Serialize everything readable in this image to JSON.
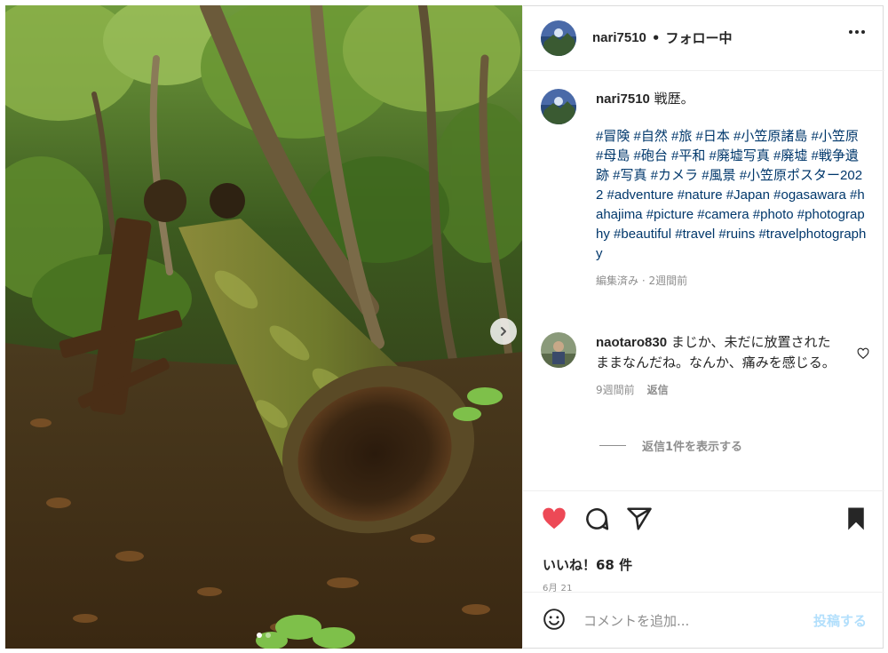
{
  "post": {
    "username": "nari7510",
    "separator": "•",
    "follow_status": "フォロー中",
    "more_icon": "more-horizontal-icon",
    "caption": {
      "username": "nari7510",
      "text": "戦歴。",
      "hashtags": "#冒険 #自然 #旅 #日本 #小笠原諸島 #小笠原 #母島 #砲台 #平和 #廃墟写真 #廃墟 #戦争遺跡 #写真 #カメラ #風景 #小笠原ポスター2022 #adventure #nature #Japan #ogasawara #hahajima #picture #camera #photo #photography #beautiful #travel #ruins #travelphotography",
      "edited": "編集済み",
      "meta_separator": "·",
      "time": "2週間前"
    },
    "comment": {
      "username": "naotaro830",
      "text": "まじか、未だに放置されたままなんだね。なんか、痛みを感じる。",
      "time": "9週間前",
      "reply_label": "返信"
    },
    "view_replies": "返信1件を表示する",
    "likes": "いいね！68 件",
    "date": "6月 21",
    "comment_placeholder": "コメントを追加...",
    "post_button": "投稿する",
    "carousel": {
      "total": 2,
      "current": 1
    }
  },
  "colors": {
    "like_red": "#ed4956",
    "hashtag_blue": "#00376b",
    "post_button_disabled": "#b2dffc",
    "meta_gray": "#8e8e8e"
  },
  "icons": [
    "heart-filled-icon",
    "comment-icon",
    "share-icon",
    "bookmark-filled-icon",
    "heart-outline-icon",
    "emoji-icon",
    "chevron-right-icon"
  ]
}
